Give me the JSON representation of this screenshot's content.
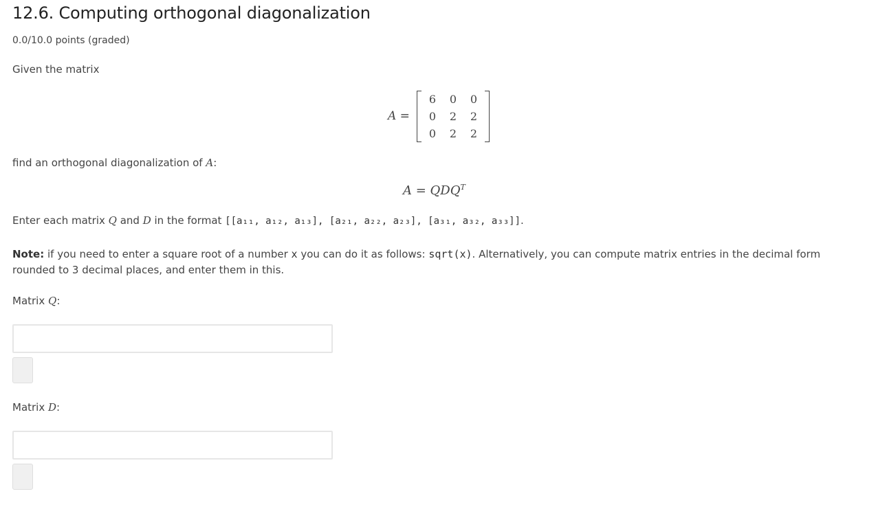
{
  "problem": {
    "title": "12.6. Computing orthogonal diagonalization",
    "points": "0.0/10.0 points (graded)",
    "intro": "Given the matrix",
    "matrix_label": "A =",
    "matrix_rows": [
      [
        "6",
        "0",
        "0"
      ],
      [
        "0",
        "2",
        "2"
      ],
      [
        "0",
        "2",
        "2"
      ]
    ],
    "find_text": "find an orthogonal diagonalization of ",
    "find_var": "A",
    "find_colon": ":",
    "decomposition": "A = QDQ",
    "decomposition_sup": "T",
    "format_text_1": "Enter each matrix ",
    "format_var_q": "Q",
    "format_text_2": " and ",
    "format_var_d": "D",
    "format_text_3": " in the format ",
    "format_code": "[[a₁₁, a₁₂, a₁₃], [a₂₁, a₂₂, a₂₃], [a₃₁, a₃₂, a₃₃]]",
    "format_end": ".",
    "note_label": "Note:",
    "note_text_1": " if you need to enter a square root of a number ",
    "note_code_x": "x",
    "note_text_2": " you can do it as follows: ",
    "note_code_sqrt": "sqrt(x)",
    "note_text_3": ". Alternatively, you can compute matrix entries in the decimal form",
    "note_text_4": "rounded to 3 decimal places, and enter them in this."
  },
  "answers": {
    "q_label": "Matrix ",
    "q_var": "Q",
    "q_colon": ":",
    "q_value": "",
    "d_label": "Matrix ",
    "d_var": "D",
    "d_colon": ":",
    "d_value": ""
  }
}
